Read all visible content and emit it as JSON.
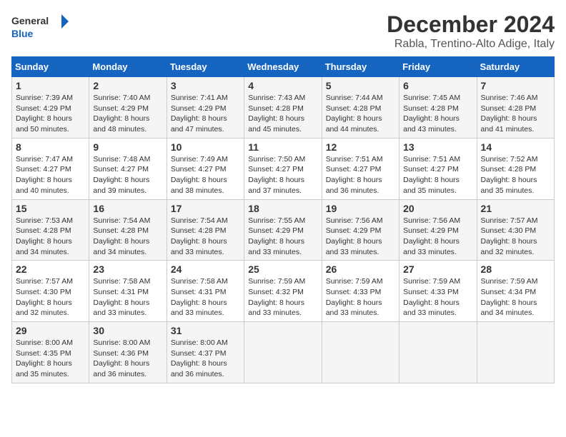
{
  "logo": {
    "line1": "General",
    "line2": "Blue"
  },
  "title": "December 2024",
  "subtitle": "Rabla, Trentino-Alto Adige, Italy",
  "weekdays": [
    "Sunday",
    "Monday",
    "Tuesday",
    "Wednesday",
    "Thursday",
    "Friday",
    "Saturday"
  ],
  "weeks": [
    [
      {
        "day": "1",
        "sunrise": "Sunrise: 7:39 AM",
        "sunset": "Sunset: 4:29 PM",
        "daylight": "Daylight: 8 hours and 50 minutes."
      },
      {
        "day": "2",
        "sunrise": "Sunrise: 7:40 AM",
        "sunset": "Sunset: 4:29 PM",
        "daylight": "Daylight: 8 hours and 48 minutes."
      },
      {
        "day": "3",
        "sunrise": "Sunrise: 7:41 AM",
        "sunset": "Sunset: 4:29 PM",
        "daylight": "Daylight: 8 hours and 47 minutes."
      },
      {
        "day": "4",
        "sunrise": "Sunrise: 7:43 AM",
        "sunset": "Sunset: 4:28 PM",
        "daylight": "Daylight: 8 hours and 45 minutes."
      },
      {
        "day": "5",
        "sunrise": "Sunrise: 7:44 AM",
        "sunset": "Sunset: 4:28 PM",
        "daylight": "Daylight: 8 hours and 44 minutes."
      },
      {
        "day": "6",
        "sunrise": "Sunrise: 7:45 AM",
        "sunset": "Sunset: 4:28 PM",
        "daylight": "Daylight: 8 hours and 43 minutes."
      },
      {
        "day": "7",
        "sunrise": "Sunrise: 7:46 AM",
        "sunset": "Sunset: 4:28 PM",
        "daylight": "Daylight: 8 hours and 41 minutes."
      }
    ],
    [
      {
        "day": "8",
        "sunrise": "Sunrise: 7:47 AM",
        "sunset": "Sunset: 4:27 PM",
        "daylight": "Daylight: 8 hours and 40 minutes."
      },
      {
        "day": "9",
        "sunrise": "Sunrise: 7:48 AM",
        "sunset": "Sunset: 4:27 PM",
        "daylight": "Daylight: 8 hours and 39 minutes."
      },
      {
        "day": "10",
        "sunrise": "Sunrise: 7:49 AM",
        "sunset": "Sunset: 4:27 PM",
        "daylight": "Daylight: 8 hours and 38 minutes."
      },
      {
        "day": "11",
        "sunrise": "Sunrise: 7:50 AM",
        "sunset": "Sunset: 4:27 PM",
        "daylight": "Daylight: 8 hours and 37 minutes."
      },
      {
        "day": "12",
        "sunrise": "Sunrise: 7:51 AM",
        "sunset": "Sunset: 4:27 PM",
        "daylight": "Daylight: 8 hours and 36 minutes."
      },
      {
        "day": "13",
        "sunrise": "Sunrise: 7:51 AM",
        "sunset": "Sunset: 4:27 PM",
        "daylight": "Daylight: 8 hours and 35 minutes."
      },
      {
        "day": "14",
        "sunrise": "Sunrise: 7:52 AM",
        "sunset": "Sunset: 4:28 PM",
        "daylight": "Daylight: 8 hours and 35 minutes."
      }
    ],
    [
      {
        "day": "15",
        "sunrise": "Sunrise: 7:53 AM",
        "sunset": "Sunset: 4:28 PM",
        "daylight": "Daylight: 8 hours and 34 minutes."
      },
      {
        "day": "16",
        "sunrise": "Sunrise: 7:54 AM",
        "sunset": "Sunset: 4:28 PM",
        "daylight": "Daylight: 8 hours and 34 minutes."
      },
      {
        "day": "17",
        "sunrise": "Sunrise: 7:54 AM",
        "sunset": "Sunset: 4:28 PM",
        "daylight": "Daylight: 8 hours and 33 minutes."
      },
      {
        "day": "18",
        "sunrise": "Sunrise: 7:55 AM",
        "sunset": "Sunset: 4:29 PM",
        "daylight": "Daylight: 8 hours and 33 minutes."
      },
      {
        "day": "19",
        "sunrise": "Sunrise: 7:56 AM",
        "sunset": "Sunset: 4:29 PM",
        "daylight": "Daylight: 8 hours and 33 minutes."
      },
      {
        "day": "20",
        "sunrise": "Sunrise: 7:56 AM",
        "sunset": "Sunset: 4:29 PM",
        "daylight": "Daylight: 8 hours and 33 minutes."
      },
      {
        "day": "21",
        "sunrise": "Sunrise: 7:57 AM",
        "sunset": "Sunset: 4:30 PM",
        "daylight": "Daylight: 8 hours and 32 minutes."
      }
    ],
    [
      {
        "day": "22",
        "sunrise": "Sunrise: 7:57 AM",
        "sunset": "Sunset: 4:30 PM",
        "daylight": "Daylight: 8 hours and 32 minutes."
      },
      {
        "day": "23",
        "sunrise": "Sunrise: 7:58 AM",
        "sunset": "Sunset: 4:31 PM",
        "daylight": "Daylight: 8 hours and 33 minutes."
      },
      {
        "day": "24",
        "sunrise": "Sunrise: 7:58 AM",
        "sunset": "Sunset: 4:31 PM",
        "daylight": "Daylight: 8 hours and 33 minutes."
      },
      {
        "day": "25",
        "sunrise": "Sunrise: 7:59 AM",
        "sunset": "Sunset: 4:32 PM",
        "daylight": "Daylight: 8 hours and 33 minutes."
      },
      {
        "day": "26",
        "sunrise": "Sunrise: 7:59 AM",
        "sunset": "Sunset: 4:33 PM",
        "daylight": "Daylight: 8 hours and 33 minutes."
      },
      {
        "day": "27",
        "sunrise": "Sunrise: 7:59 AM",
        "sunset": "Sunset: 4:33 PM",
        "daylight": "Daylight: 8 hours and 33 minutes."
      },
      {
        "day": "28",
        "sunrise": "Sunrise: 7:59 AM",
        "sunset": "Sunset: 4:34 PM",
        "daylight": "Daylight: 8 hours and 34 minutes."
      }
    ],
    [
      {
        "day": "29",
        "sunrise": "Sunrise: 8:00 AM",
        "sunset": "Sunset: 4:35 PM",
        "daylight": "Daylight: 8 hours and 35 minutes."
      },
      {
        "day": "30",
        "sunrise": "Sunrise: 8:00 AM",
        "sunset": "Sunset: 4:36 PM",
        "daylight": "Daylight: 8 hours and 36 minutes."
      },
      {
        "day": "31",
        "sunrise": "Sunrise: 8:00 AM",
        "sunset": "Sunset: 4:37 PM",
        "daylight": "Daylight: 8 hours and 36 minutes."
      },
      null,
      null,
      null,
      null
    ]
  ]
}
